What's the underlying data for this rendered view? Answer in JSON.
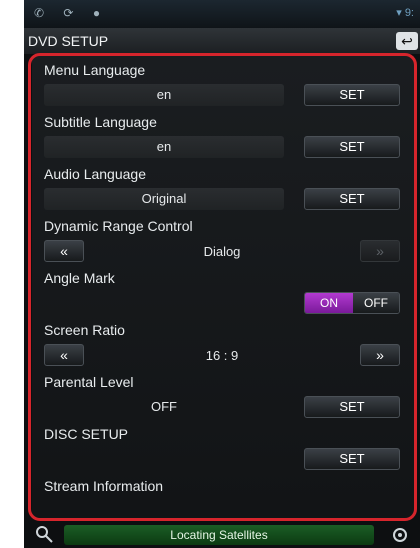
{
  "status_bar": {
    "icons": [
      "notification-icon",
      "sync-icon",
      "alert-icon"
    ],
    "right_text": "9:"
  },
  "title_bar": {
    "title": "DVD SETUP",
    "back_icon": "back-arrow-icon"
  },
  "settings": {
    "menu_language": {
      "label": "Menu Language",
      "value": "en",
      "button": "SET"
    },
    "subtitle_language": {
      "label": "Subtitle Language",
      "value": "en",
      "button": "SET"
    },
    "audio_language": {
      "label": "Audio Language",
      "value": "Original",
      "button": "SET"
    },
    "dynamic_range": {
      "label": "Dynamic Range Control",
      "value": "Dialog",
      "prev": "«",
      "next": "»"
    },
    "angle_mark": {
      "label": "Angle Mark",
      "on": "ON",
      "off": "OFF",
      "selected": "ON"
    },
    "screen_ratio": {
      "label": "Screen Ratio",
      "value": "16 : 9",
      "prev": "«",
      "next": "»"
    },
    "parental_level": {
      "label": "Parental Level",
      "value": "OFF",
      "button": "SET"
    },
    "disc_setup": {
      "label": "DISC SETUP",
      "button": "SET"
    },
    "stream_info": {
      "label": "Stream Information"
    }
  },
  "bottom_bar": {
    "left_icon": "search-icon",
    "status": "Locating Satellites",
    "right_icon": "settings-icon"
  },
  "colors": {
    "accent": "#b23ad0",
    "frame": "#d6252c",
    "gps": "#1b5e25"
  }
}
